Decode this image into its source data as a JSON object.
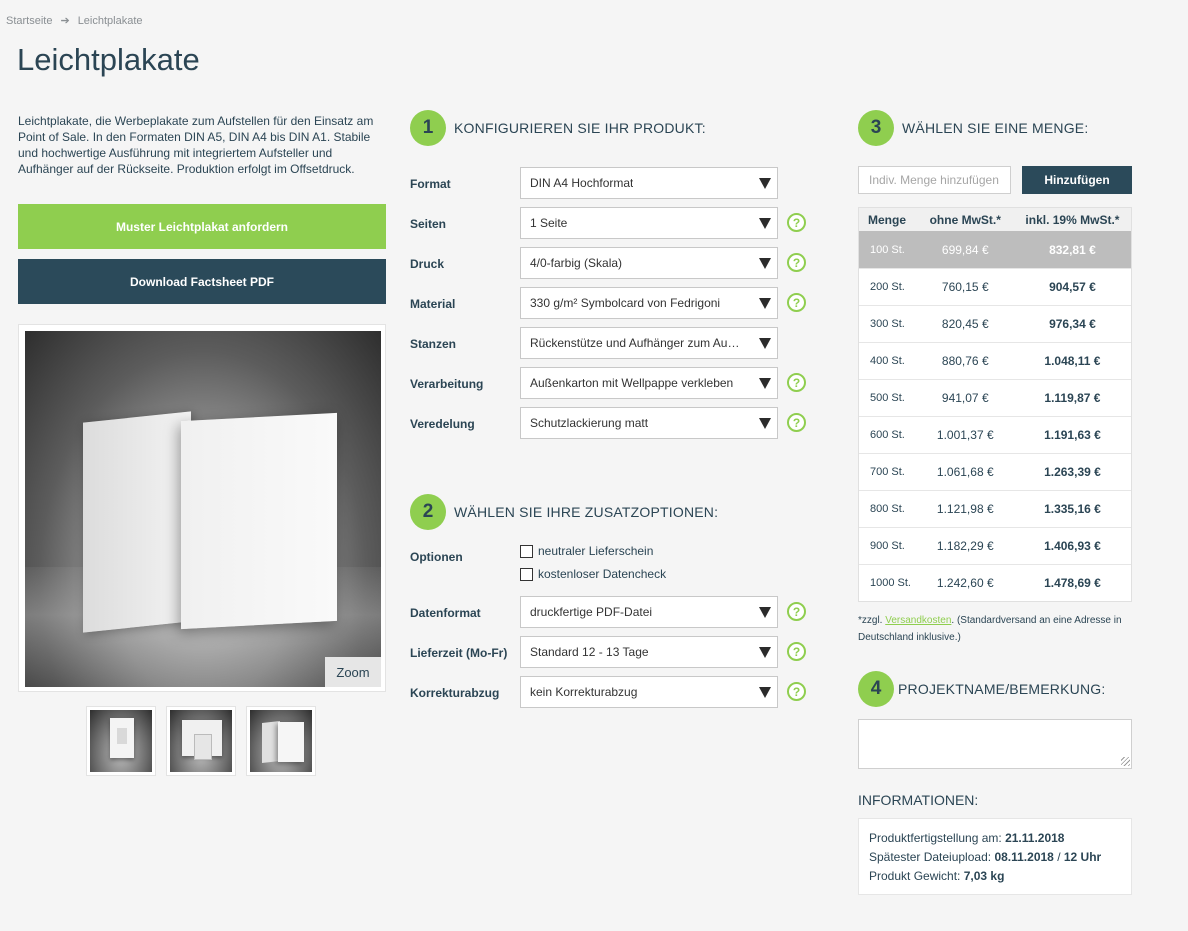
{
  "breadcrumb": {
    "home": "Startseite",
    "current": "Leichtplakate"
  },
  "page_title": "Leichtplakate",
  "intro_text": "Leichtplakate, die Werbeplakate zum Aufstellen für den Einsatz am Point of Sale. In den Formaten DIN A5, DIN A4 bis DIN A1. Stabile und hochwertige Ausführung mit integriertem Aufsteller und Aufhänger auf der Rückseite. Produktion erfolgt im Offsetdruck.",
  "buttons": {
    "sample": "Muster Leichtplakat anfordern",
    "factsheet": "Download Factsheet PDF"
  },
  "image": {
    "zoom_label": "Zoom"
  },
  "step1": {
    "number": "1",
    "title": "KONFIGURIEREN SIE IHR PRODUKT:",
    "rows": [
      {
        "label": "Format",
        "value": "DIN A4 Hochformat",
        "help": false
      },
      {
        "label": "Seiten",
        "value": "1 Seite",
        "help": true
      },
      {
        "label": "Druck",
        "value": "4/0-farbig (Skala)",
        "help": true
      },
      {
        "label": "Material",
        "value": "330 g/m² Symbolcard von Fedrigoni",
        "help": true
      },
      {
        "label": "Stanzen",
        "value": "Rückenstütze und Aufhänger zum Aus…",
        "help": false
      },
      {
        "label": "Verarbeitung",
        "value": "Außenkarton mit Wellpappe verkleben",
        "help": true
      },
      {
        "label": "Veredelung",
        "value": "Schutzlackierung matt",
        "help": true
      }
    ]
  },
  "step2": {
    "number": "2",
    "title": "WÄHLEN SIE IHRE ZUSATZOPTIONEN:",
    "options_label": "Optionen",
    "checkboxes": [
      "neutraler Lieferschein",
      "kostenloser Datencheck"
    ],
    "rows": [
      {
        "label": "Datenformat",
        "value": "druckfertige PDF-Datei",
        "help": true
      },
      {
        "label": "Lieferzeit (Mo-Fr)",
        "value": "Standard 12 - 13 Tage",
        "help": true
      },
      {
        "label": "Korrekturabzug",
        "value": "kein Korrekturabzug",
        "help": true
      }
    ]
  },
  "help_glyph": "?",
  "step3": {
    "number": "3",
    "title": "WÄHLEN SIE EINE MENGE:",
    "input_placeholder": "Indiv. Menge hinzufügen",
    "add_button": "Hinzufügen",
    "headers": [
      "Menge",
      "ohne MwSt.*",
      "inkl. 19% MwSt.*"
    ],
    "selected_index": 0,
    "rows": [
      [
        "100 St.",
        "699,84 €",
        "832,81 €"
      ],
      [
        "200 St.",
        "760,15 €",
        "904,57 €"
      ],
      [
        "300 St.",
        "820,45 €",
        "976,34 €"
      ],
      [
        "400 St.",
        "880,76 €",
        "1.048,11 €"
      ],
      [
        "500 St.",
        "941,07 €",
        "1.119,87 €"
      ],
      [
        "600 St.",
        "1.001,37 €",
        "1.191,63 €"
      ],
      [
        "700 St.",
        "1.061,68 €",
        "1.263,39 €"
      ],
      [
        "800 St.",
        "1.121,98 €",
        "1.335,16 €"
      ],
      [
        "900 St.",
        "1.182,29 €",
        "1.406,93 €"
      ],
      [
        "1000 St.",
        "1.242,60 €",
        "1.478,69 €"
      ]
    ],
    "footnote_prefix": "*zzgl.",
    "footnote_link": "Versandkosten",
    "footnote_suffix": ". (Standardversand an eine Adresse in Deutschland inklusive.)"
  },
  "step4": {
    "number": "4",
    "title": "PROJEKTNAME/BEMERKUNG:"
  },
  "info": {
    "title": "INFORMATIONEN:",
    "line1_label": "Produktfertigstellung am:",
    "line1_value": "21.11.2018",
    "line2_label": "Spätester Dateiupload:",
    "line2_value": "08.11.2018",
    "line2_sep": "/",
    "line2_value2": "12 Uhr",
    "line3_label": "Produkt Gewicht:",
    "line3_value": "7,03 kg"
  },
  "colors": {
    "accent": "#8fce4f",
    "dark": "#2b4a5a",
    "text": "#2b4554"
  }
}
